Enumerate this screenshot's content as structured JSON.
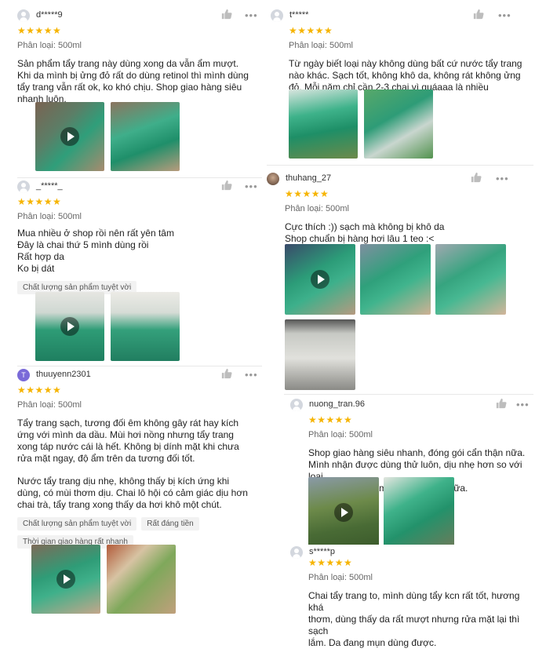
{
  "reviews": [
    {
      "username": "d*****9",
      "variant": "Phân loại: 500ml",
      "text": "Sản phẩm tẩy trang này dùng xong da vẫn ẩm mượt.\nKhi da mình bị ửng đỏ rất do dùng retinol thì mình dùng\ntẩy trang vẫn rất ok, ko khó chịu. Shop giao hàng siêu\nnhanh luôn."
    },
    {
      "username": "_*****_",
      "variant": "Phân loại: 500ml",
      "text": "Mua nhiều ở shop rồi nên rất yên tâm\nĐây là chai thứ 5 mình dùng rồi\nRất hợp da\nKo bị dát",
      "tags": [
        "Chất lượng sản phẩm tuyệt vời"
      ]
    },
    {
      "username": "thuuyenn2301",
      "avatar_letter": "T",
      "variant": "Phân loại: 500ml",
      "text": "Tẩy trang sạch, tương đối êm không gây rát hay kích\nứng với mình da dầu. Mùi hơi nồng nhưng tẩy trang\nxong táp nước cái là hết. Không bị dính mặt khi chưa\nrửa mặt ngay, độ ẩm trên da tương đối tốt.",
      "text2": "Nước tẩy trang dịu nhẹ, không thấy bị kích ứng khi\ndùng, có mùi thơm dịu. Chai lô hội có cảm giác dịu hơn\nchai trà, tẩy trang xong thấy da hơi khô một chút.",
      "tags": [
        "Chất lượng sản phẩm tuyệt vời",
        "Rất đáng tiền",
        "Thời gian giao hàng rất nhanh"
      ]
    },
    {
      "username": "t*****",
      "variant": "Phân loại: 500ml",
      "text": "Từ ngày biết loại này không dùng bất cứ nước tẩy trang\nnào khác. Sạch tốt, không khô da, không rát không ửng\nđỏ. Mỗi năm chỉ cần 2-3 chai vì quáaaa là nhiều"
    },
    {
      "username": "thuhang_27",
      "variant": "Phân loại: 500ml",
      "text": "Cực thích :)) sạch mà không bị khô da\nShop chuẩn bị hàng hơi lâu 1 teo :<"
    },
    {
      "username": "nuong_tran.96",
      "variant": "Phân loại: 500ml",
      "text": "Shop giao hàng siêu nhanh, đóng gói cẩn thận nữa.\nMình nhận được dùng thử luôn, dịu nhẹ hơn so với loại\nmình đang dùng mà lại sạch hơn nữa."
    },
    {
      "username": "s*****p",
      "variant": "Phân loại: 500ml",
      "text": "Chai tẩy trang to, mình dùng tẩy kcn rất tốt, hương khá\nthơm, dùng thấy da rất mượt nhưng rửa mặt lại thì sạch\nlắm. Da đang mụn dùng được."
    }
  ],
  "stars": "★★★★★",
  "more_label": "•••",
  "icons": {
    "like": "thumb-up-icon",
    "more": "more-options-icon",
    "play": "play-icon"
  },
  "colors": {
    "star": "#f6b400",
    "text": "#222222",
    "muted": "#666666",
    "tag_bg": "#f2f2f2"
  }
}
